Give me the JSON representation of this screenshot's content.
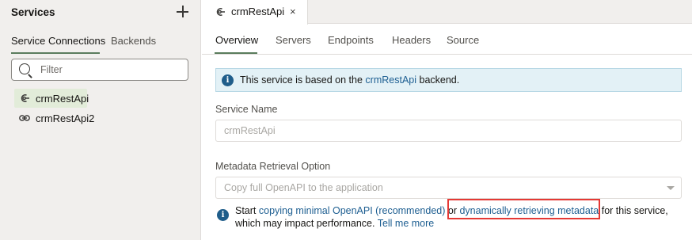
{
  "sidebar": {
    "title": "Services",
    "tabs": [
      {
        "label": "Service Connections"
      },
      {
        "label": "Backends"
      }
    ],
    "filter_placeholder": "Filter",
    "items": [
      {
        "label": "crmRestApi"
      },
      {
        "label": "crmRestApi2"
      }
    ]
  },
  "editor": {
    "doc_tab": {
      "label": "crmRestApi",
      "close": "×"
    },
    "tabs": [
      {
        "label": "Overview"
      },
      {
        "label": "Servers"
      },
      {
        "label": "Endpoints"
      },
      {
        "label": "Headers"
      },
      {
        "label": "Source"
      }
    ],
    "banner": {
      "prefix": "This service is based on the ",
      "link": "crmRestApi",
      "suffix": " backend."
    },
    "service_name": {
      "label": "Service Name",
      "value": "crmRestApi"
    },
    "metadata": {
      "label": "Metadata Retrieval Option",
      "value": "Copy full OpenAPI to the application"
    },
    "help": {
      "start": "Start ",
      "link1": "copying minimal OpenAPI (recommended)",
      "or": " or ",
      "link2": "dynamically retrieving metadata",
      "after": " for this service,",
      "line2": "which may impact performance. ",
      "link3": "Tell me more"
    }
  },
  "colors": {
    "accent": "#5a7c5d",
    "link": "#1d5e91",
    "info_bg": "#e3f1f6",
    "highlight": "#e53935"
  },
  "icons": [
    "plus-icon",
    "search-icon",
    "service-connection-icon",
    "link-icon",
    "close-icon",
    "info-icon",
    "chevron-down-icon"
  ]
}
